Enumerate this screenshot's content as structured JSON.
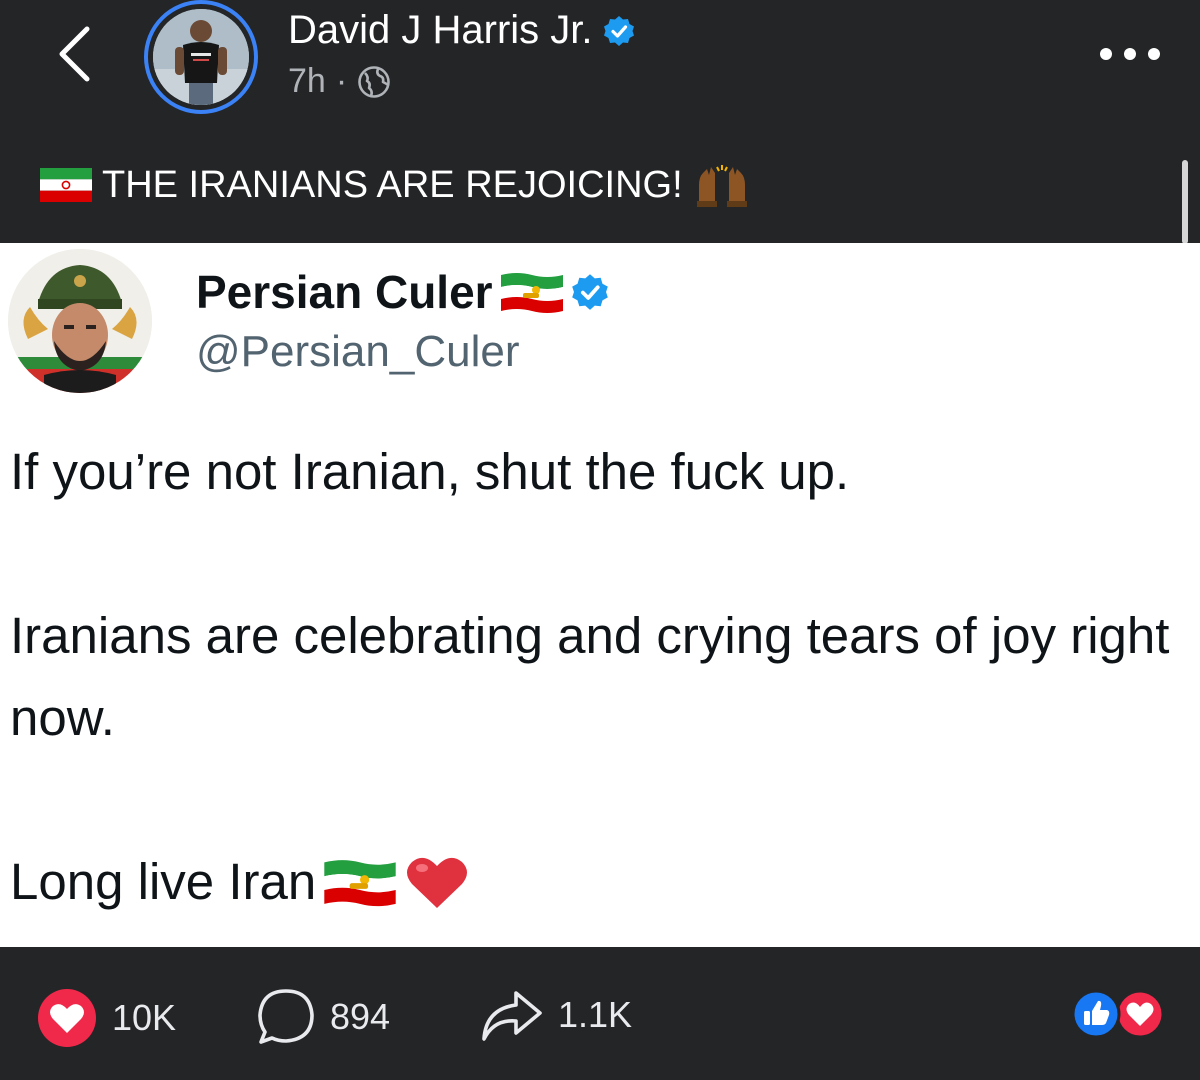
{
  "header": {
    "back_icon": "chevron-left-icon",
    "poster_name": "David J Harris Jr.",
    "verified_icon": "verified-badge-icon",
    "timestamp": "7h",
    "separator": "·",
    "audience_icon": "globe-icon",
    "more_icon": "more-horizontal-icon"
  },
  "caption": {
    "flag_icon": "iran-flag-icon",
    "text": "THE IRANIANS ARE REJOICING!",
    "emoji_icon": "raising-hands-icon"
  },
  "tweet": {
    "author_name": "Persian Culer",
    "author_flag_icon": "iran-lion-sun-flag-icon",
    "verified_icon": "verified-badge-icon",
    "handle": "@Persian_Culer",
    "paragraphs": {
      "p1": "If you’re not Iranian, shut the fuck up.",
      "p2": "Iranians are celebrating and crying tears of joy right now.",
      "p3": "Long live Iran"
    },
    "p3_icons": [
      "iran-lion-sun-flag-icon",
      "red-heart-icon"
    ]
  },
  "footer": {
    "like_count": "10K",
    "comment_count": "894",
    "share_count": "1.1K",
    "reaction_icons": [
      "like-reaction-icon",
      "love-reaction-icon"
    ]
  },
  "colors": {
    "app_background": "#232527",
    "tweet_background": "#ffffff",
    "verified_blue": "#1d9bf0",
    "facebook_blue": "#1877f2",
    "love_red": "#f0284a",
    "avatar_ring": "#3b82f6"
  }
}
